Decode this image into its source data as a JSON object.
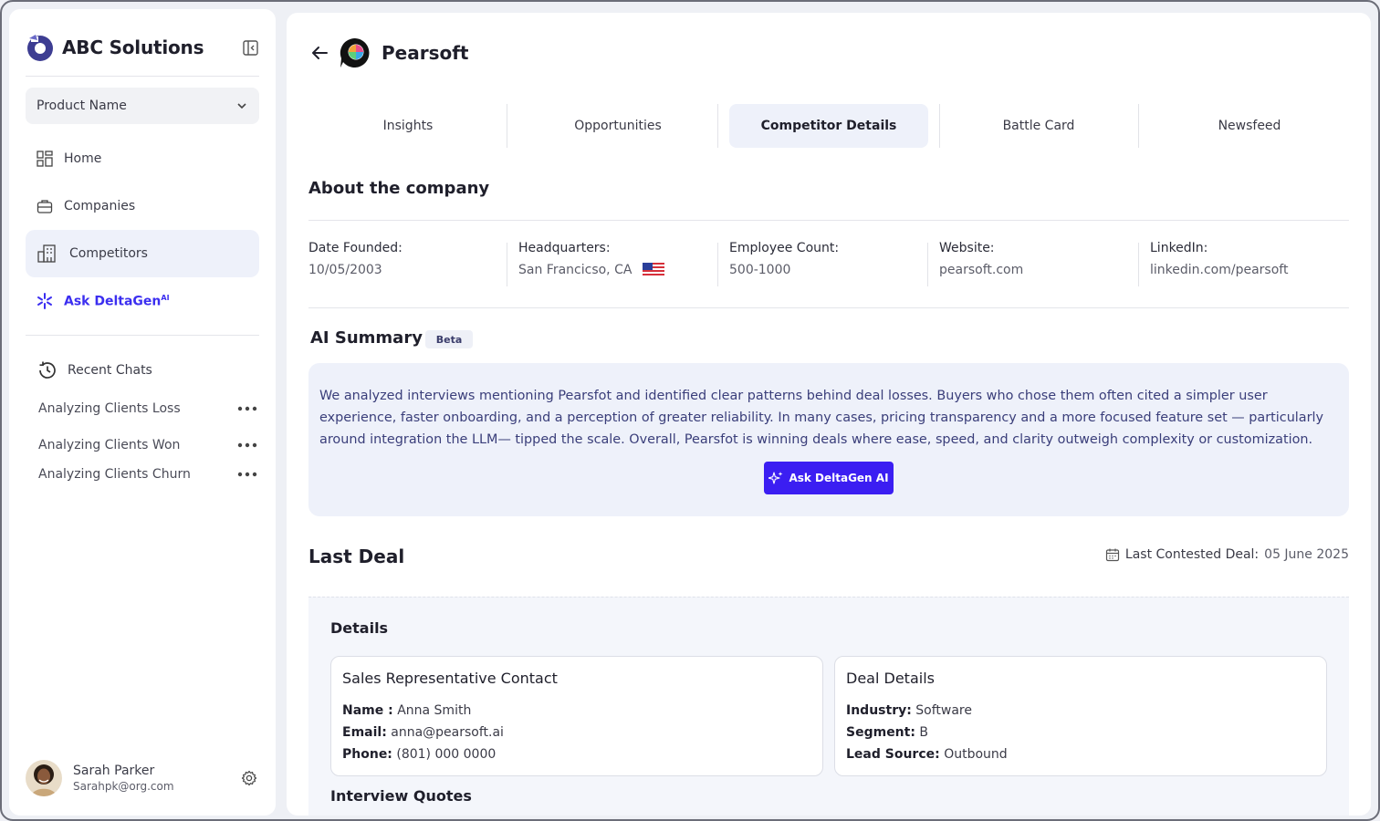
{
  "brand": {
    "name": "ABC Solutions"
  },
  "sidebar": {
    "product_select": "Product Name",
    "nav": [
      {
        "label": "Home",
        "icon": "grid-icon"
      },
      {
        "label": "Companies",
        "icon": "briefcase-icon"
      },
      {
        "label": "Competitors",
        "icon": "buildings-icon"
      }
    ],
    "ask": {
      "label": "Ask DeltaGen",
      "sup": "AI"
    },
    "recent_title": "Recent Chats",
    "chats": [
      "Analyzing Clients Loss",
      "Analyzing Clients Won",
      "Analyzing Clients Churn"
    ],
    "user": {
      "name": "Sarah Parker",
      "email": "Sarahpk@org.com"
    }
  },
  "company": {
    "name": "Pearsoft"
  },
  "tabs": [
    "Insights",
    "Opportunities",
    "Competitor Details",
    "Battle Card",
    "Newsfeed"
  ],
  "active_tab": "Competitor Details",
  "about": {
    "title": "About the company",
    "fields": [
      {
        "label": "Date Founded:",
        "value": "10/05/2003"
      },
      {
        "label": "Headquarters:",
        "value": "San Francicso, CA"
      },
      {
        "label": "Employee Count:",
        "value": "500-1000"
      },
      {
        "label": "Website:",
        "value": "pearsoft.com"
      },
      {
        "label": "LinkedIn:",
        "value": "linkedin.com/pearsoft"
      }
    ]
  },
  "ai_summary": {
    "title": "AI Summary",
    "badge": "Beta",
    "text": "We analyzed interviews mentioning Pearsfot and identified clear patterns behind deal losses. Buyers who chose them often cited a simpler user experience, faster onboarding, and a perception of greater reliability. In many cases, pricing transparency and a more focused feature set — particularly around integration the LLM— tipped the scale. Overall, Pearsfot is winning deals where ease, speed, and clarity outweigh complexity or customization.",
    "button": "Ask DeltaGen AI"
  },
  "last_deal": {
    "title": "Last Deal",
    "meta_label": "Last Contested Deal:",
    "meta_value": "05 June 2025",
    "details_title": "Details",
    "sales_card": {
      "title": "Sales Representative Contact",
      "rows": [
        {
          "label": "Name :",
          "value": "Anna Smith"
        },
        {
          "label": "Email:",
          "value": "anna@pearsoft.ai"
        },
        {
          "label": "Phone:",
          "value": "(801) 000 0000"
        }
      ]
    },
    "deal_card": {
      "title": "Deal Details",
      "rows": [
        {
          "label": "Industry:",
          "value": "Software"
        },
        {
          "label": "Segment:",
          "value": "B"
        },
        {
          "label": "Lead Source:",
          "value": " Outbound"
        }
      ]
    },
    "quotes_title": "Interview Quotes"
  },
  "colors": {
    "accent": "#3b1ef2",
    "active_bg": "#eef1fa",
    "summary_text": "#3a3e7a"
  }
}
